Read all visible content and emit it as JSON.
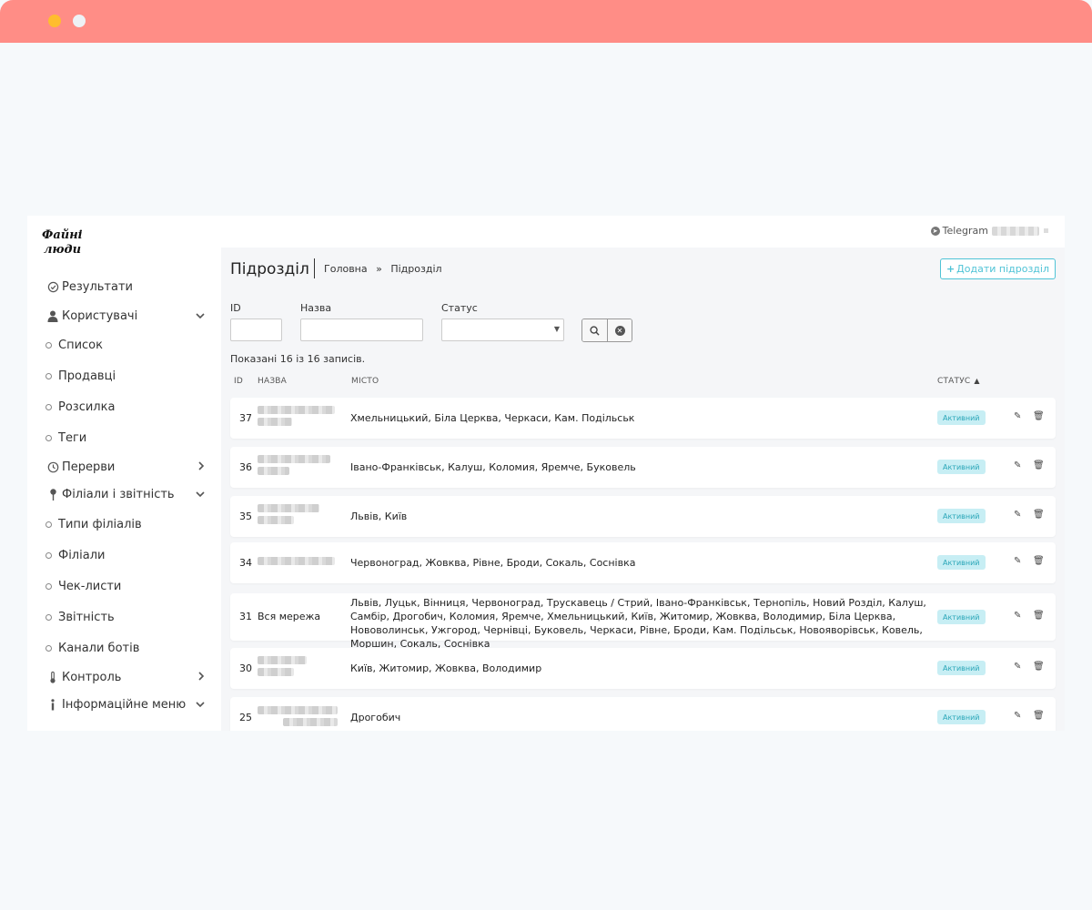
{
  "sidebar": {
    "logo": "Файні люди",
    "items": [
      {
        "label": "Результати",
        "icon": "check-circle-icon"
      },
      {
        "label": "Користувачі",
        "icon": "user-icon",
        "chevron": "down"
      },
      {
        "label": "Список",
        "icon": "circle-icon"
      },
      {
        "label": "Продавці",
        "icon": "circle-icon"
      },
      {
        "label": "Розсилка",
        "icon": "circle-icon"
      },
      {
        "label": "Теги",
        "icon": "circle-icon"
      },
      {
        "label": "Перерви",
        "icon": "clock-icon",
        "chevron": "right"
      },
      {
        "label": "Філіали і звітність",
        "icon": "pin-icon",
        "chevron": "down"
      },
      {
        "label": "Типи філіалів",
        "icon": "circle-icon"
      },
      {
        "label": "Філіали",
        "icon": "circle-icon"
      },
      {
        "label": "Чек-листи",
        "icon": "circle-icon"
      },
      {
        "label": "Звітність",
        "icon": "circle-icon"
      },
      {
        "label": "Канали ботів",
        "icon": "circle-icon"
      },
      {
        "label": "Контроль",
        "icon": "thermometer-icon",
        "chevron": "right"
      },
      {
        "label": "Інформаційне меню",
        "icon": "info-icon",
        "chevron": "down"
      }
    ]
  },
  "topbar": {
    "telegram_label": "Telegram"
  },
  "header": {
    "title": "Підрозділ",
    "breadcrumb_home": "Головна",
    "breadcrumb_sep": "»",
    "breadcrumb_current": "Підрозділ",
    "add_button": "Додати підрозділ"
  },
  "filters": {
    "id_label": "ID",
    "name_label": "Назва",
    "status_label": "Статус",
    "id_value": "",
    "name_value": "",
    "status_value": ""
  },
  "showing_text": "Показані 16 із 16 записів.",
  "table": {
    "headers": {
      "id": "ID",
      "name": "НАЗВА",
      "city": "МІСТО",
      "status": "СТАТУС"
    },
    "rows": [
      {
        "id": "37",
        "name": "",
        "city": "Хмельницький, Біла Церква, Черкаси, Кам. Подільськ",
        "status": "Активний"
      },
      {
        "id": "36",
        "name": "",
        "city": "Івано-Франківськ, Калуш, Коломия, Яремче, Буковель",
        "status": "Активний"
      },
      {
        "id": "35",
        "name": "",
        "city": "Львів, Київ",
        "status": "Активний"
      },
      {
        "id": "34",
        "name": "",
        "city": "Червоноград, Жовква, Рівне, Броди, Сокаль, Соснівка",
        "status": "Активний"
      },
      {
        "id": "31",
        "name": "Вся мережа",
        "city": "Львів, Луцьк, Вінниця, Червоноград, Трускавець / Стрий, Івано-Франківськ, Тернопіль, Новий Розділ, Калуш, Самбір, Дрогобич, Коломия, Яремче, Хмельницький, Київ, Житомир, Жовква, Володимир, Біла Церква, Нововолинськ, Ужгород, Чернівці, Буковель, Черкаси, Рівне, Броди, Кам. Подільськ, Новояворівськ, Ковель, Моршин, Сокаль, Соснівка",
        "status": "Активний"
      },
      {
        "id": "30",
        "name": "",
        "city": "Київ, Житомир, Жовква, Володимир",
        "status": "Активний"
      },
      {
        "id": "25",
        "name": "",
        "city": "Дрогобич",
        "status": "Активний"
      }
    ]
  }
}
